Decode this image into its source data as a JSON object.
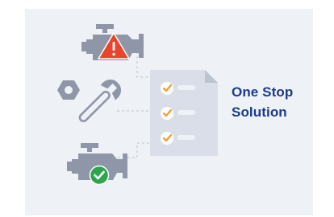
{
  "banner": {
    "headline_line1": "One Stop",
    "headline_line2": "Solution"
  },
  "icons": {
    "top": "engine-warning-icon",
    "middle": "nut-and-wrench-icon",
    "bottom": "engine-ok-icon",
    "document": "checklist-document-icon"
  },
  "colors": {
    "panel_background": "#eef2f7",
    "headline": "#1b3a8c",
    "engine_gray": "#8e96a8",
    "warning_red": "#e8452c",
    "ok_green": "#2ea44f",
    "check_orange": "#f39a1f"
  }
}
